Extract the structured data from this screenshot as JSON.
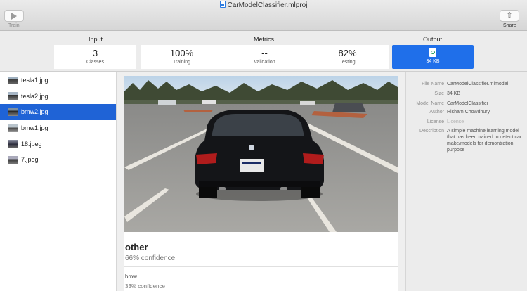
{
  "window": {
    "title": "CarModelClassifier.mlproj"
  },
  "toolbar": {
    "train_label": "Train",
    "share_label": "Share"
  },
  "sections": {
    "input": "Input",
    "metrics": "Metrics",
    "output": "Output"
  },
  "cards": {
    "classes": {
      "value": "3",
      "label": "Classes"
    },
    "training": {
      "value": "100%",
      "label": "Training"
    },
    "validation": {
      "value": "--",
      "label": "Validation"
    },
    "testing": {
      "value": "82%",
      "label": "Testing"
    },
    "output": {
      "label": "34 KB",
      "icon": "mlmodel-file-icon"
    }
  },
  "files": [
    {
      "name": "tesla1.jpg"
    },
    {
      "name": "tesla2.jpg"
    },
    {
      "name": "bmw2.jpg",
      "selected": true
    },
    {
      "name": "bmw1.jpg"
    },
    {
      "name": "18.jpeg"
    },
    {
      "name": "7.jpeg"
    }
  ],
  "prediction": {
    "top": {
      "label": "other",
      "confidence": "66% confidence"
    },
    "second": {
      "label": "bmw",
      "confidence": "33% confidence"
    }
  },
  "details": {
    "file_name": {
      "key": "File Name",
      "value": "CarModelClassifier.mlmodel"
    },
    "size": {
      "key": "Size",
      "value": "34 KB"
    },
    "model_name": {
      "key": "Model Name",
      "value": "CarModelClassifier"
    },
    "author": {
      "key": "Author",
      "value": "Hisham Chowdhury"
    },
    "license": {
      "key": "License",
      "value": "License"
    },
    "description": {
      "key": "Description",
      "value": "A simple machine learning model that has been trained to detect car make/models for demontration purpose"
    }
  },
  "colors": {
    "accent": "#1f6fea",
    "selection": "#1f63d6"
  }
}
